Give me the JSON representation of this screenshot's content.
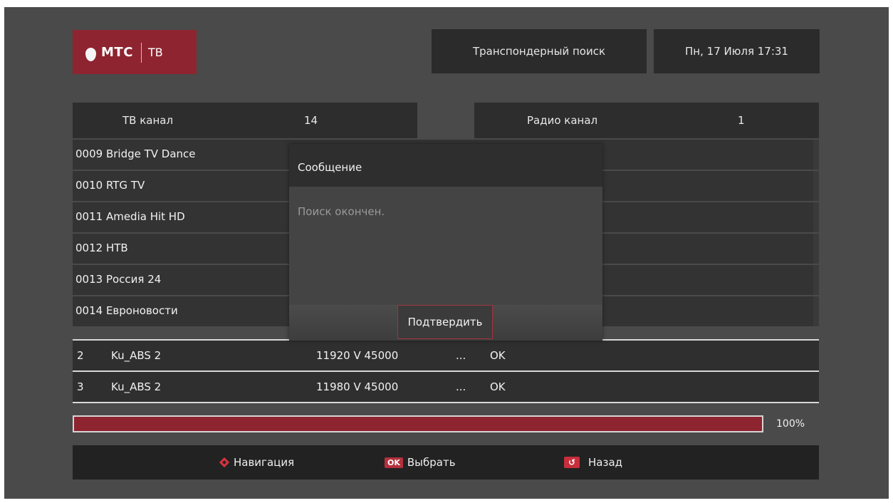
{
  "brand": {
    "name": "МТС",
    "product": "ТВ"
  },
  "header": {
    "search_mode": "Транспондерный поиск",
    "datetime": "Пн, 17 Июля 17:31"
  },
  "counts": {
    "tv_label": "ТВ канал",
    "tv_value": "14",
    "radio_label": "Радио канал",
    "radio_value": "1"
  },
  "channels": [
    {
      "label": "0009  Bridge TV Dance"
    },
    {
      "label": "0010  RTG TV"
    },
    {
      "label": "0011  Amedia Hit HD"
    },
    {
      "label": "0012  НТВ"
    },
    {
      "label": "0013  Россия 24"
    },
    {
      "label": "0014  Евроновости"
    }
  ],
  "dialog": {
    "title": "Сообщение",
    "message": "Поиск окончен.",
    "confirm": "Подтвердить"
  },
  "transponders": [
    {
      "num": "2",
      "sat": "Ku_ABS 2",
      "freq": "11920 V 45000",
      "dots": "...",
      "status": "OK"
    },
    {
      "num": "3",
      "sat": "Ku_ABS 2",
      "freq": "11980 V 45000",
      "dots": "...",
      "status": "OK"
    }
  ],
  "progress": {
    "fraction": 1.0,
    "label": "100%"
  },
  "footer": {
    "nav_label": "Навигация",
    "ok_key": "OK",
    "select_label": "Выбрать",
    "back_label": "Назад"
  },
  "colors": {
    "accent": "#8e2430",
    "screen_bg": "#4a4a4a",
    "bar_bg": "#222222"
  },
  "icons": {
    "navigation": "dpad-icon",
    "ok": "ok-key-icon",
    "back": "back-key-icon",
    "logo": "mts-egg-icon"
  }
}
